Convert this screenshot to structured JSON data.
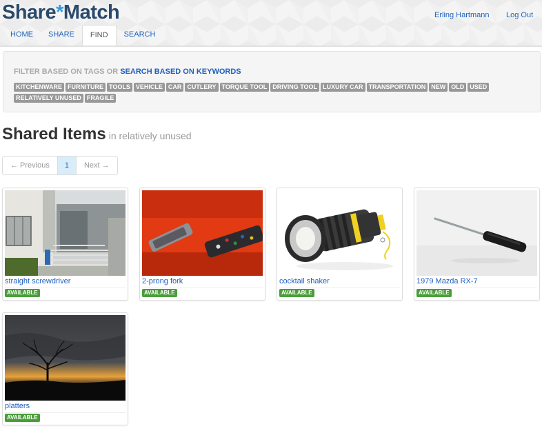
{
  "brand": {
    "part1": "Share",
    "star": "*",
    "part2": "Match"
  },
  "header": {
    "user_name": "Erling Hartmann",
    "logout_label": "Log Out"
  },
  "nav": {
    "items": [
      {
        "label": "HOME"
      },
      {
        "label": "SHARE"
      },
      {
        "label": "FIND"
      },
      {
        "label": "SEARCH"
      }
    ],
    "active": "FIND"
  },
  "filter": {
    "prefix": "FILTER BASED ON TAGS OR",
    "keyword_link": "SEARCH BASED ON KEYWORDS",
    "tags": [
      "KITCHENWARE",
      "FURNITURE",
      "TOOLS",
      "VEHICLE",
      "CAR",
      "CUTLERY",
      "TORQUE TOOL",
      "DRIVING TOOL",
      "LUXURY CAR",
      "TRANSPORTATION",
      "NEW",
      "OLD",
      "USED",
      "RELATIVELY UNUSED",
      "FRAGILE"
    ]
  },
  "main": {
    "title": "Shared Items",
    "subtitle": "in relatively unused"
  },
  "pager": {
    "prev": "← Previous",
    "current": "1",
    "next": "Next →"
  },
  "items": [
    {
      "title": "straight screwdriver",
      "status": "AVAILABLE",
      "image": "building-entrance-photo"
    },
    {
      "title": "2-prong fork",
      "status": "AVAILABLE",
      "image": "remote-controls-photo"
    },
    {
      "title": "cocktail shaker",
      "status": "AVAILABLE",
      "image": "flashlight-photo"
    },
    {
      "title": "1979 Mazda RX-7",
      "status": "AVAILABLE",
      "image": "screwdriver-photo"
    },
    {
      "title": "platters",
      "status": "AVAILABLE",
      "image": "sunset-tree-photo"
    }
  ],
  "colors": {
    "link": "#1f5fbf",
    "available": "#4a9e3a",
    "tag": "#999999",
    "brand": "#2b4a6b"
  }
}
